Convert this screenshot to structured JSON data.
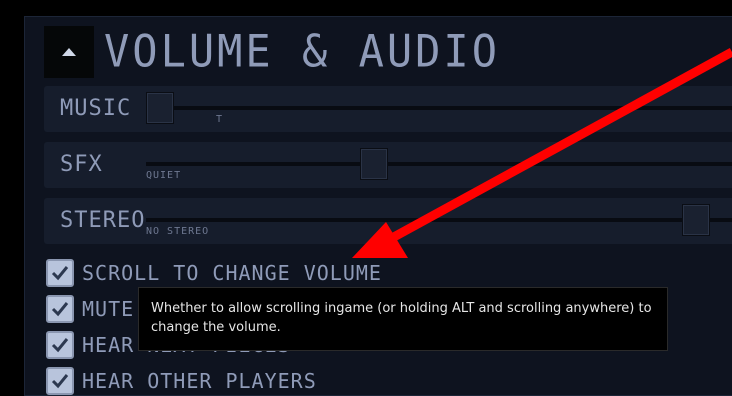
{
  "section": {
    "title": "VOLUME & AUDIO"
  },
  "sliders": [
    {
      "label": "MUSIC",
      "sublabel": "T",
      "level": 0.0
    },
    {
      "label": "SFX",
      "sublabel": "QUIET",
      "level": 0.35
    },
    {
      "label": "STEREO",
      "sublabel": "NO STEREO",
      "level": 0.93
    }
  ],
  "checkboxes": [
    {
      "label": "SCROLL TO CHANGE VOLUME",
      "checked": true
    },
    {
      "label": "MUTE",
      "checked": true
    },
    {
      "label": "HEAR NEXT PIECES",
      "checked": true
    },
    {
      "label": "HEAR OTHER PLAYERS",
      "checked": true
    }
  ],
  "tooltip": {
    "text": "Whether to allow scrolling ingame (or holding ALT and scrolling anywhere) to change the volume."
  },
  "colors": {
    "panel_bg": "#0e131f",
    "row_bg": "#161d2c",
    "text": "#8f9bb8",
    "annotation_arrow": "#ff0000"
  }
}
